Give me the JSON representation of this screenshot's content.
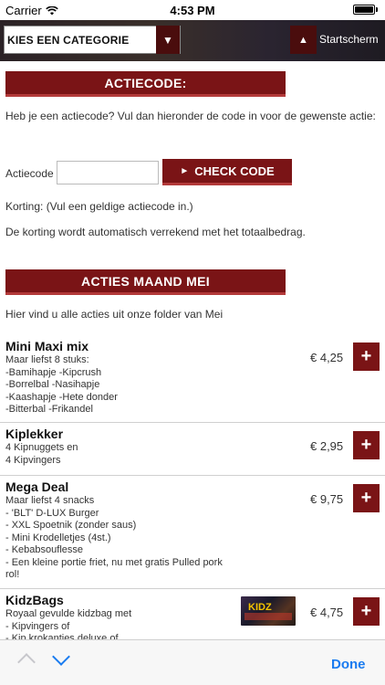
{
  "status": {
    "carrier": "Carrier",
    "time": "4:53 PM"
  },
  "topnav": {
    "category_select": "KIES EEN CATEGORIE",
    "home_label": "Startscherm"
  },
  "actiecode": {
    "heading": "ACTIECODE:",
    "intro": "Heb je een actiecode? Vul dan hieronder de code in voor de gewenste actie:",
    "code_label": "Actiecode",
    "code_value": "",
    "check_button": "CHECK CODE",
    "korting": "Korting: (Vul een geldige actiecode in.)",
    "note": "De korting wordt automatisch verrekend met het totaalbedrag."
  },
  "acties": {
    "heading": "ACTIES MAAND MEI",
    "intro": "Hier vind u alle acties uit onze folder van Mei",
    "products": [
      {
        "name": "Mini Maxi mix",
        "desc": "Maar liefst 8 stuks:\n-Bamihapje -Kipcrush\n-Borrelbal -Nasihapje\n-Kaashapje -Hete donder\n-Bitterbal -Frikandel",
        "price": "€ 4,25"
      },
      {
        "name": "Kiplekker",
        "desc": "4 Kipnuggets en\n4 Kipvingers",
        "price": "€ 2,95"
      },
      {
        "name": "Mega Deal",
        "desc": "Maar liefst 4 snacks\n- 'BLT' D-LUX Burger\n- XXL Spoetnik (zonder saus)\n- Mini Krodelletjes (4st.)\n- Kebabsouflesse\n- Een kleine portie friet, nu met gratis Pulled pork rol!",
        "price": "€ 9,75"
      },
      {
        "name": "KidzBags",
        "desc": "Royaal gevulde kidzbag met\n- Kipvingers of\n- Kip krokantjes deluxe of",
        "price": "€ 4,75",
        "thumb_text": "KIDZ"
      }
    ],
    "add_symbol": "+"
  },
  "toolbar": {
    "done": "Done"
  }
}
